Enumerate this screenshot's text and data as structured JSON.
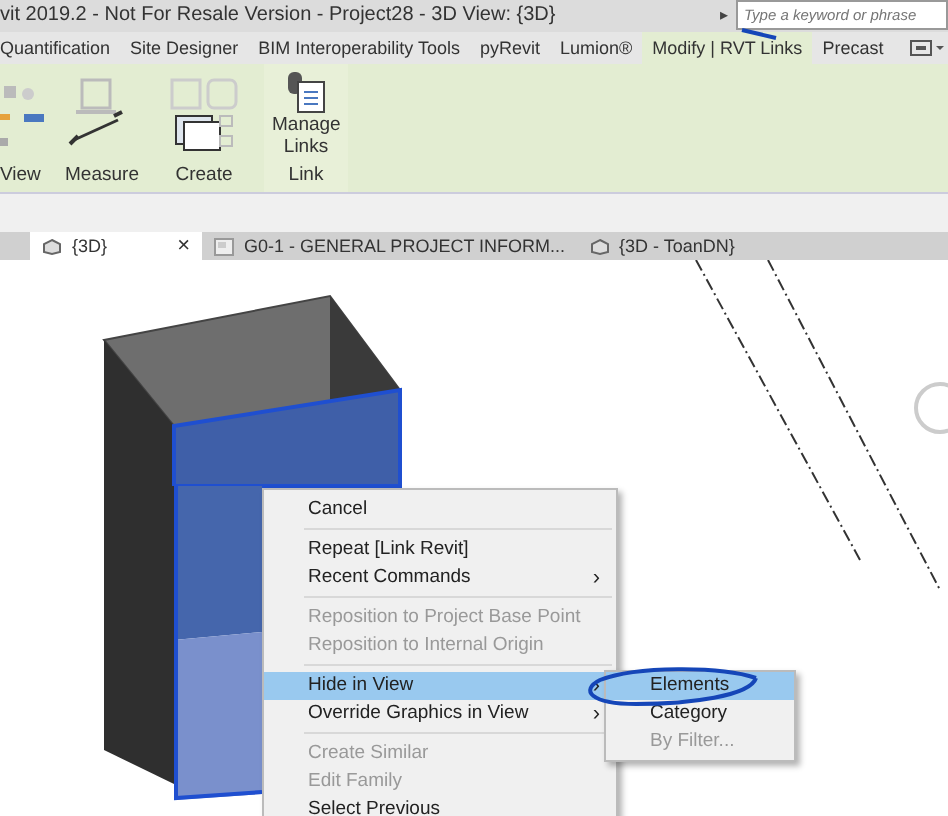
{
  "window": {
    "title": "vit 2019.2 - Not For Resale Version - Project28 - 3D View: {3D}"
  },
  "search": {
    "expander": "▸",
    "placeholder": "Type a keyword or phrase"
  },
  "ribbon_tabs": [
    {
      "label": "Quantification",
      "selected": false
    },
    {
      "label": "Site Designer",
      "selected": false
    },
    {
      "label": "BIM Interoperability Tools",
      "selected": false
    },
    {
      "label": "pyRevit",
      "selected": false
    },
    {
      "label": "Lumion®",
      "selected": false
    },
    {
      "label": "Modify | RVT Links",
      "selected": true
    },
    {
      "label": "Precast",
      "selected": false
    }
  ],
  "ribbon_panels": [
    {
      "kind": "view",
      "label": "View"
    },
    {
      "kind": "measure",
      "label": "Measure"
    },
    {
      "kind": "create",
      "label": "Create"
    },
    {
      "kind": "link",
      "label": "Link",
      "button": "Manage Links"
    }
  ],
  "view_tabs": [
    {
      "label": "{3D}",
      "kind": "model",
      "selected": true,
      "close": "×"
    },
    {
      "label": "G0-1 - GENERAL PROJECT INFORM...",
      "kind": "sheet",
      "selected": false
    },
    {
      "label": "{3D - ToanDN}",
      "kind": "model",
      "selected": false
    }
  ],
  "context_menu": [
    {
      "kind": "item",
      "label": "Cancel",
      "disabled": false,
      "selected": false
    },
    {
      "kind": "separator"
    },
    {
      "kind": "item",
      "label": "Repeat [Link Revit]",
      "disabled": false,
      "selected": false
    },
    {
      "kind": "item",
      "label": "Recent Commands",
      "disabled": false,
      "selected": false,
      "arrow": "›"
    },
    {
      "kind": "separator"
    },
    {
      "kind": "item",
      "label": "Reposition to Project Base Point",
      "disabled": true,
      "selected": false
    },
    {
      "kind": "item",
      "label": "Reposition to Internal Origin",
      "disabled": true,
      "selected": false
    },
    {
      "kind": "separator"
    },
    {
      "kind": "item",
      "label": "Hide in View",
      "disabled": false,
      "selected": true,
      "arrow": "›"
    },
    {
      "kind": "item",
      "label": "Override Graphics in View",
      "disabled": false,
      "selected": false,
      "arrow": "›"
    },
    {
      "kind": "separator"
    },
    {
      "kind": "item",
      "label": "Create Similar",
      "disabled": true,
      "selected": false
    },
    {
      "kind": "item",
      "label": "Edit Family",
      "disabled": true,
      "selected": false
    },
    {
      "kind": "item",
      "label": "Select Previous",
      "disabled": false,
      "selected": false
    }
  ],
  "submenu": [
    {
      "label": "Elements",
      "disabled": false,
      "selected": true
    },
    {
      "label": "Category",
      "disabled": false,
      "selected": false
    },
    {
      "label": "By Filter...",
      "disabled": true,
      "selected": false
    }
  ]
}
